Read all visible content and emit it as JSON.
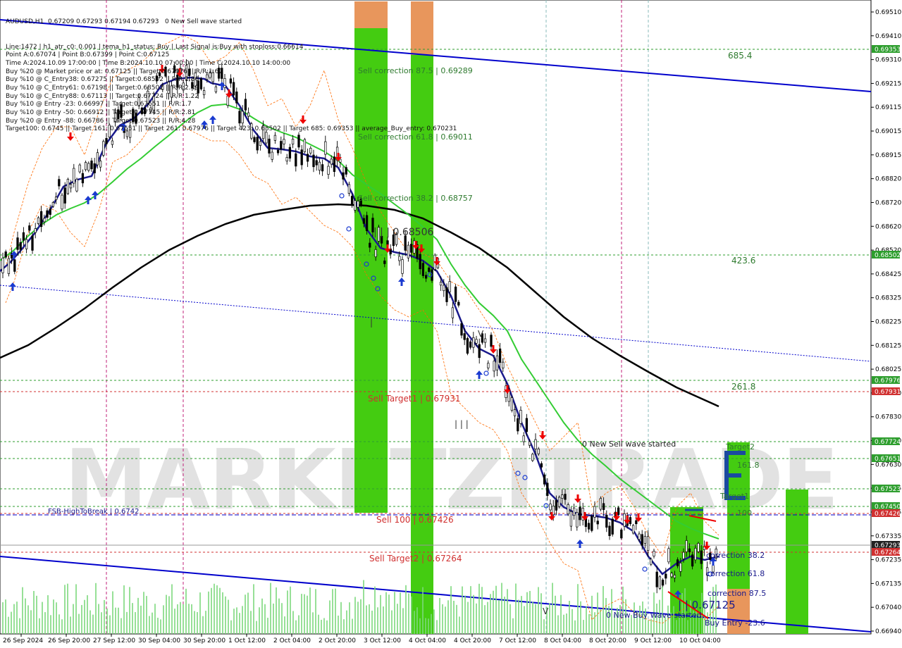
{
  "header": {
    "symbol_line": "AUDUSD,H1  0.67209 0.67293 0.67194 0.67293",
    "banner": "0 New Sell wave started",
    "lines": [
      "Line:1472 | h1_atr_c0: 0.001 | tema_h1_status: Buy | Last Signal is:Buy with stoploss:0.66614",
      "Point A:0.67074 | Point B:0.67399 | Point C:0.67125",
      "Time A:2024.10.09 17:00:00 | Time B:2024.10.10 07:00:00 | Time C:2024.10.10 14:00:00",
      "Buy %20 @ Market price or at: 0.67125 || Target:0.67976 || R/R:1.67",
      "Buy %10 @ C_Entry38: 0.67275 || Target:0.68502 || R/R:1.86",
      "Buy %10 @ C_Entry61: 0.67198 || Target:0.68502 || R/R:2.49",
      "Buy %10 @ C_Entry88: 0.67113 || Target:0.67724 || R/R:1.22",
      "Buy %10 @ Entry -23: 0.66997 || Target:0.67651 || R/R:1.7",
      "Buy %10 @ Entry -50: 0.66912 || Target:0.67745 || R/R:2.81",
      "Buy %20 @ Entry -88: 0.66786 || Target:0.67523 || R/R:4.28",
      "Target100: 0.6745 || Target 161: 0.67651 || Target 261: 0.67976 || Target 423: 0.68502 || Target 685: 0.69353 || average_Buy_entry: 0.670231"
    ]
  },
  "price_axis": {
    "ticks": [
      "0.69510",
      "0.69410",
      "0.69310",
      "0.69215",
      "0.69115",
      "0.69015",
      "0.68915",
      "0.68820",
      "0.68720",
      "0.68620",
      "0.68520",
      "0.68425",
      "0.68325",
      "0.68225",
      "0.68125",
      "0.68025",
      "0.67930",
      "0.67830",
      "0.67730",
      "0.67630",
      "0.67535",
      "0.67435",
      "0.67335",
      "0.67235",
      "0.67135",
      "0.67040",
      "0.66940"
    ],
    "tags": [
      {
        "value": "0.69353",
        "color": "#2e9e2e"
      },
      {
        "value": "0.68502",
        "color": "#2e9e2e"
      },
      {
        "value": "0.67976",
        "color": "#2e9e2e"
      },
      {
        "value": "0.67931",
        "color": "#d03030"
      },
      {
        "value": "0.67724",
        "color": "#2e9e2e"
      },
      {
        "value": "0.67651",
        "color": "#2e9e2e"
      },
      {
        "value": "0.67523",
        "color": "#2e9e2e"
      },
      {
        "value": "0.67450",
        "color": "#2e9e2e"
      },
      {
        "value": "0.67426",
        "color": "#d03030"
      },
      {
        "value": "0.67293",
        "color": "#222222"
      },
      {
        "value": "0.67264",
        "color": "#d03030"
      }
    ]
  },
  "time_axis": [
    "26 Sep 2024",
    "26 Sep 20:00",
    "27 Sep 12:00",
    "30 Sep 04:00",
    "30 Sep 20:00",
    "1 Oct 12:00",
    "2 Oct 04:00",
    "2 Oct 20:00",
    "3 Oct 12:00",
    "4 Oct 04:00",
    "4 Oct 20:00",
    "7 Oct 12:00",
    "8 Oct 04:00",
    "8 Oct 20:00",
    "9 Oct 12:00",
    "10 Oct 04:00"
  ],
  "annotations": {
    "sell_correction_875": "Sell correction 87.5 | 0.69289",
    "sell_correction_618": "Sell correction 61.8 | 0.69011",
    "sell_correction_382": "Sell correction 38.2 | 0.68757",
    "point_label": "| | | 0.68506",
    "sell_target1": "Sell Target1 | 0.67931",
    "sell_100": "Sell 100 | 0.67426",
    "sell_target2": "Sell Target2 | 0.67264",
    "fsb": "FSB-HighToBreak | 0.6742",
    "new_sell_wave": "0 New Sell wave started",
    "new_buy_wave": "0 New Buy Wave started",
    "level_685": "685.4",
    "level_423": "423.6",
    "level_261": "261.8",
    "target2": "Target2",
    "level_161": "161.8",
    "target1": "Target1",
    "level_100": "100",
    "correction_382": "correction 38.2",
    "correction_618": "correction 61.8",
    "correction_875": "correction 87.5",
    "point_c": "| | 0.67125",
    "buy_entry": "Buy Entry -23.6",
    "small_v1": "V",
    "small_v2": "V",
    "bars_mark": "| | |",
    "single_bar": "|"
  },
  "watermark": "MARKETZITRADE",
  "colors": {
    "green_bar": "#44cc11",
    "orange_bar": "#e8965c",
    "navy": "#1a1a8c",
    "ma_green": "#33cc33",
    "ma_black": "#000000",
    "blue_channel": "#0000cc",
    "grid_green": "#2e9e2e",
    "grid_red": "#d03030"
  }
}
